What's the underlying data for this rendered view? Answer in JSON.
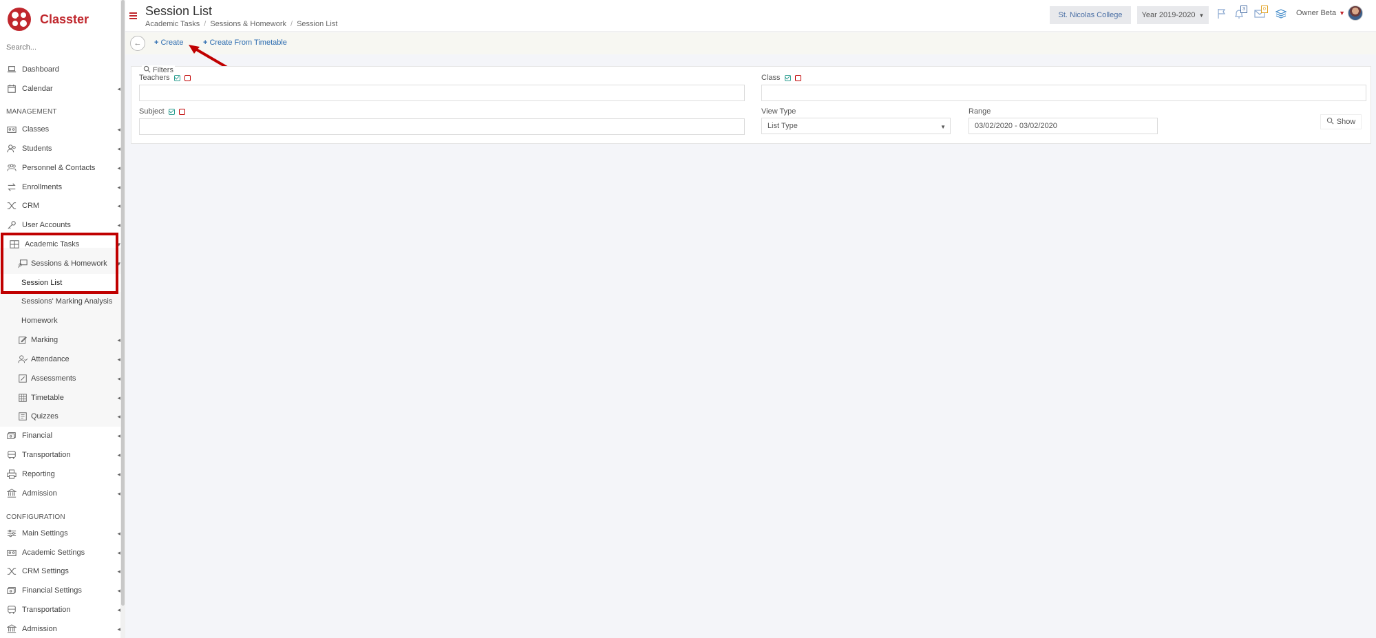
{
  "brand": {
    "name": "Classter",
    "color": "#c0272d"
  },
  "sidebar": {
    "search_placeholder": "Search...",
    "top_items": [
      {
        "label": "Dashboard",
        "icon": "laptop-icon"
      },
      {
        "label": "Calendar",
        "icon": "calendar-icon"
      }
    ],
    "management_label": "MANAGEMENT",
    "management_items": [
      {
        "label": "Classes",
        "icon": "classes-icon"
      },
      {
        "label": "Students",
        "icon": "students-icon"
      },
      {
        "label": "Personnel & Contacts",
        "icon": "personnel-icon"
      },
      {
        "label": "Enrollments",
        "icon": "enrollments-icon"
      },
      {
        "label": "CRM",
        "icon": "crm-icon"
      },
      {
        "label": "User Accounts",
        "icon": "key-icon"
      },
      {
        "label": "Academic Tasks",
        "icon": "grid-icon"
      },
      {
        "label": "Sessions & Homework",
        "icon": "sessions-icon"
      },
      {
        "label": "Session List"
      },
      {
        "label": "Sessions' Marking Analysis"
      },
      {
        "label": "Homework"
      },
      {
        "label": "Marking",
        "icon": "edit-icon"
      },
      {
        "label": "Attendance",
        "icon": "attendance-icon"
      },
      {
        "label": "Assessments",
        "icon": "assessments-icon"
      },
      {
        "label": "Timetable",
        "icon": "timetable-icon"
      },
      {
        "label": "Quizzes",
        "icon": "quizzes-icon"
      },
      {
        "label": "Financial",
        "icon": "financial-icon"
      },
      {
        "label": "Transportation",
        "icon": "bus-icon"
      },
      {
        "label": "Reporting",
        "icon": "printer-icon"
      },
      {
        "label": "Admission",
        "icon": "bank-icon"
      }
    ],
    "configuration_label": "CONFIGURATION",
    "configuration_items": [
      {
        "label": "Main Settings",
        "icon": "sliders-icon"
      },
      {
        "label": "Academic Settings",
        "icon": "classes-icon"
      },
      {
        "label": "CRM Settings",
        "icon": "crm-icon"
      },
      {
        "label": "Financial Settings",
        "icon": "financial-icon"
      },
      {
        "label": "Transportation",
        "icon": "bus-icon"
      },
      {
        "label": "Admission",
        "icon": "bank-icon"
      }
    ]
  },
  "header": {
    "title": "Session List",
    "breadcrumb": [
      "Academic Tasks",
      "Sessions & Homework",
      "Session List"
    ],
    "college": "St. Nicolas College",
    "year": "Year 2019-2020",
    "notifications_count": "3",
    "messages_count": "0",
    "user": "Owner Beta"
  },
  "toolbar": {
    "create_label": "Create",
    "create_from_timetable_label": "Create From Timetable"
  },
  "filters": {
    "title": "Filters",
    "teachers_label": "Teachers",
    "class_label": "Class",
    "subject_label": "Subject",
    "view_type_label": "View Type",
    "view_type_value": "List Type",
    "range_label": "Range",
    "range_value": "03/02/2020 - 03/02/2020",
    "show_label": "Show"
  }
}
